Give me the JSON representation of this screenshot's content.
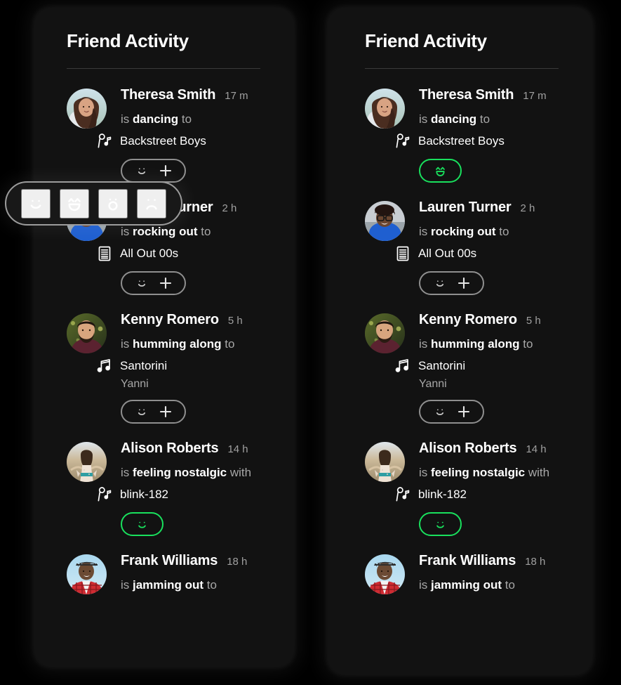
{
  "theme": {
    "page_background": "#000000",
    "card_background": "#121212",
    "accent_green": "#19E05D",
    "text_primary": "#FFFFFF",
    "text_secondary": "#A7A7A7",
    "pill_border": "#8F8F8F",
    "divider": "#3A3A3A"
  },
  "panel": {
    "title": "Friend Activity"
  },
  "activities": [
    {
      "name": "Theresa Smith",
      "timestamp": "17 m",
      "action_prefix": "is",
      "action": "dancing",
      "action_suffix": "to",
      "context_icon": "artist-icon",
      "context": "Backstreet Boys",
      "subtitle": "",
      "avatar": "avatar-theresa"
    },
    {
      "name": "Lauren Turner",
      "timestamp": "2 h",
      "action_prefix": "is",
      "action": "rocking out",
      "action_suffix": "to",
      "context_icon": "playlist-icon",
      "context": "All Out 00s",
      "subtitle": "",
      "avatar": "avatar-lauren"
    },
    {
      "name": "Kenny Romero",
      "timestamp": "5 h",
      "action_prefix": "is",
      "action": "humming along",
      "action_suffix": "to",
      "context_icon": "music-note-icon",
      "context": "Santorini",
      "subtitle": "Yanni",
      "avatar": "avatar-kenny"
    },
    {
      "name": "Alison Roberts",
      "timestamp": "14 h",
      "action_prefix": "is",
      "action": "feeling nostalgic",
      "action_suffix": "with",
      "context_icon": "artist-icon",
      "context": "blink-182",
      "subtitle": "",
      "avatar": "avatar-alison"
    },
    {
      "name": "Frank Williams",
      "timestamp": "18 h",
      "action_prefix": "is",
      "action": "jamming out",
      "action_suffix": "to",
      "context_icon": "",
      "context": "",
      "subtitle": "",
      "avatar": "avatar-frank"
    }
  ],
  "reactions": {
    "add_icon": "plus-icon",
    "default_face": "smile-face-icon",
    "left_panel_states": [
      "add",
      "add",
      "add",
      "reacted-smile",
      "none"
    ],
    "right_panel_states": [
      "reacted-grin",
      "add",
      "add",
      "reacted-smile",
      "none"
    ]
  },
  "emoji_picker": {
    "visible": true,
    "attached_to": "Theresa Smith",
    "options": [
      {
        "name": "smile-face-icon",
        "label": "smile"
      },
      {
        "name": "grin-face-icon",
        "label": "grin"
      },
      {
        "name": "surprised-face-icon",
        "label": "surprised"
      },
      {
        "name": "frown-face-icon",
        "label": "frown"
      }
    ]
  }
}
